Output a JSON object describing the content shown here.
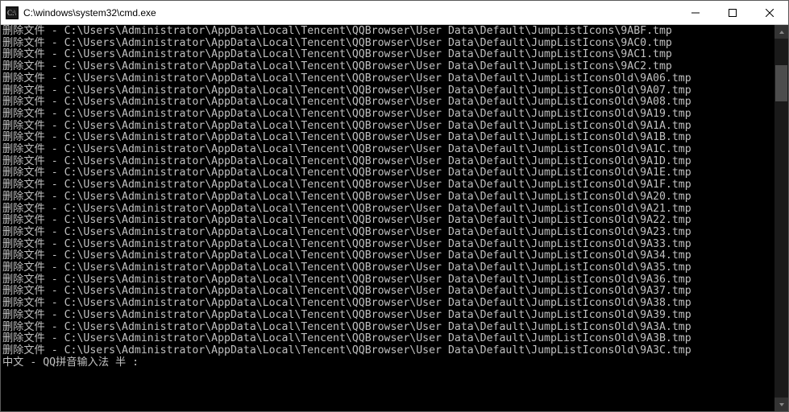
{
  "window": {
    "title": "C:\\windows\\system32\\cmd.exe"
  },
  "console": {
    "prefix": "删除文件 - ",
    "base_path_icons": "C:\\Users\\Administrator\\AppData\\Local\\Tencent\\QQBrowser\\User Data\\Default\\JumpListIcons\\",
    "base_path_old": "C:\\Users\\Administrator\\AppData\\Local\\Tencent\\QQBrowser\\User Data\\Default\\JumpListIconsOld\\",
    "lines": [
      {
        "dir": "icons",
        "file": "9ABF.tmp"
      },
      {
        "dir": "icons",
        "file": "9AC0.tmp"
      },
      {
        "dir": "icons",
        "file": "9AC1.tmp"
      },
      {
        "dir": "icons",
        "file": "9AC2.tmp"
      },
      {
        "dir": "old",
        "file": "9A06.tmp"
      },
      {
        "dir": "old",
        "file": "9A07.tmp"
      },
      {
        "dir": "old",
        "file": "9A08.tmp"
      },
      {
        "dir": "old",
        "file": "9A19.tmp"
      },
      {
        "dir": "old",
        "file": "9A1A.tmp"
      },
      {
        "dir": "old",
        "file": "9A1B.tmp"
      },
      {
        "dir": "old",
        "file": "9A1C.tmp"
      },
      {
        "dir": "old",
        "file": "9A1D.tmp"
      },
      {
        "dir": "old",
        "file": "9A1E.tmp"
      },
      {
        "dir": "old",
        "file": "9A1F.tmp"
      },
      {
        "dir": "old",
        "file": "9A20.tmp"
      },
      {
        "dir": "old",
        "file": "9A21.tmp"
      },
      {
        "dir": "old",
        "file": "9A22.tmp"
      },
      {
        "dir": "old",
        "file": "9A23.tmp"
      },
      {
        "dir": "old",
        "file": "9A33.tmp"
      },
      {
        "dir": "old",
        "file": "9A34.tmp"
      },
      {
        "dir": "old",
        "file": "9A35.tmp"
      },
      {
        "dir": "old",
        "file": "9A36.tmp"
      },
      {
        "dir": "old",
        "file": "9A37.tmp"
      },
      {
        "dir": "old",
        "file": "9A38.tmp"
      },
      {
        "dir": "old",
        "file": "9A39.tmp"
      },
      {
        "dir": "old",
        "file": "9A3A.tmp"
      },
      {
        "dir": "old",
        "file": "9A3B.tmp"
      },
      {
        "dir": "old",
        "file": "9A3C.tmp"
      }
    ],
    "ime_status": "中文 - QQ拼音输入法 半 :"
  }
}
